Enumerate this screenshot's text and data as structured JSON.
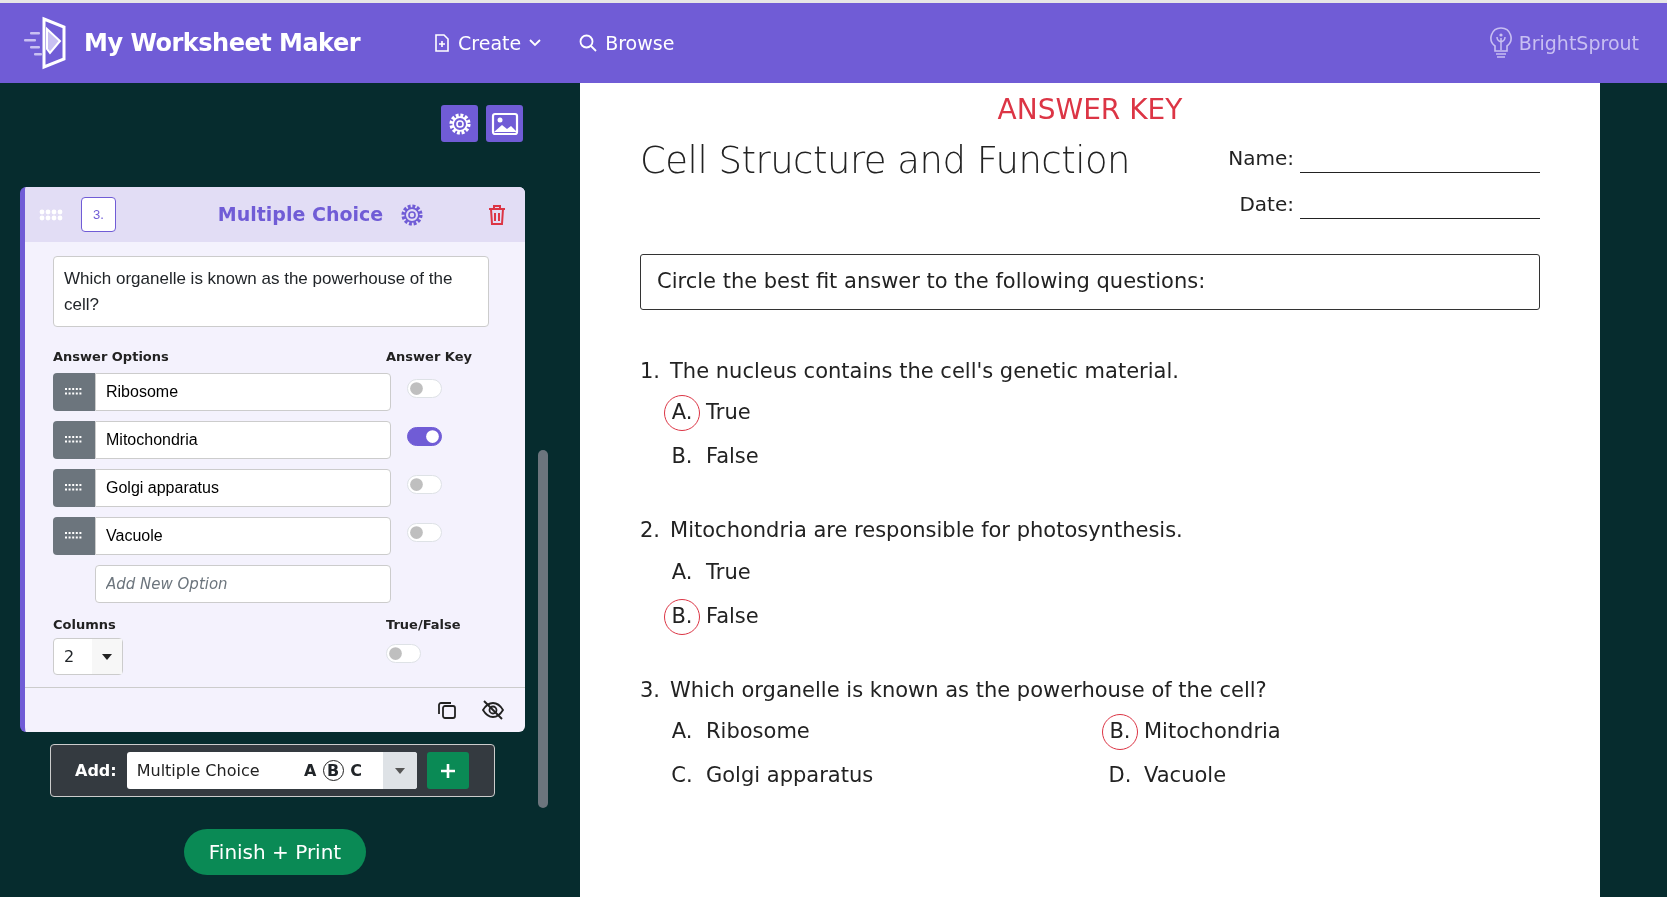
{
  "navbar": {
    "brand": "My Worksheet Maker",
    "links": [
      {
        "kind": "create",
        "label": "Create"
      },
      {
        "kind": "browse",
        "label": "Browse"
      }
    ],
    "partner": "BrightSprout"
  },
  "editor": {
    "card": {
      "number": "3.",
      "type_label": "Multiple Choice",
      "question": "Which organelle is known as the powerhouse of the cell?",
      "options_heading": "Answer Options",
      "key_heading": "Answer Key",
      "options": [
        {
          "text": "Ribosome",
          "on": false
        },
        {
          "text": "Mitochondria",
          "on": true
        },
        {
          "text": "Golgi apparatus",
          "on": false
        },
        {
          "text": "Vacuole",
          "on": false
        }
      ],
      "new_option_placeholder": "Add New Option",
      "columns_label": "Columns",
      "columns_value": "2",
      "true_false_label": "True/False",
      "true_false_on": false
    },
    "add_bar": {
      "label": "Add:",
      "type": "Multiple Choice",
      "icon_letters": [
        {
          "letter": "A",
          "selected": false
        },
        {
          "letter": "B",
          "selected": true
        },
        {
          "letter": "C",
          "selected": false
        }
      ]
    },
    "finish_button": "Finish + Print"
  },
  "worksheet": {
    "banner": "ANSWER KEY",
    "title": "Cell Structure and Function",
    "fields": [
      "Name:",
      "Date:"
    ],
    "instructions": "Circle the best fit answer to the following questions:",
    "questions": [
      {
        "number": "1.",
        "text": "The nucleus contains the cell's genetic material.",
        "kind": "single",
        "answers": [
          {
            "letter": "A.",
            "text": "True",
            "selected": true
          },
          {
            "letter": "B.",
            "text": "False",
            "selected": false
          }
        ]
      },
      {
        "number": "2.",
        "text": "Mitochondria are responsible for photosynthesis.",
        "kind": "single",
        "answers": [
          {
            "letter": "A.",
            "text": "True",
            "selected": false
          },
          {
            "letter": "B.",
            "text": "False",
            "selected": true
          }
        ]
      },
      {
        "number": "3.",
        "text": "Which organelle is known as the powerhouse of the cell?",
        "kind": "double",
        "answers": [
          {
            "letter": "A.",
            "text": "Ribosome",
            "selected": false
          },
          {
            "letter": "B.",
            "text": "Mitochondria",
            "selected": true
          },
          {
            "letter": "C.",
            "text": "Golgi apparatus",
            "selected": false
          },
          {
            "letter": "D.",
            "text": "Vacuole",
            "selected": false
          }
        ]
      }
    ]
  }
}
